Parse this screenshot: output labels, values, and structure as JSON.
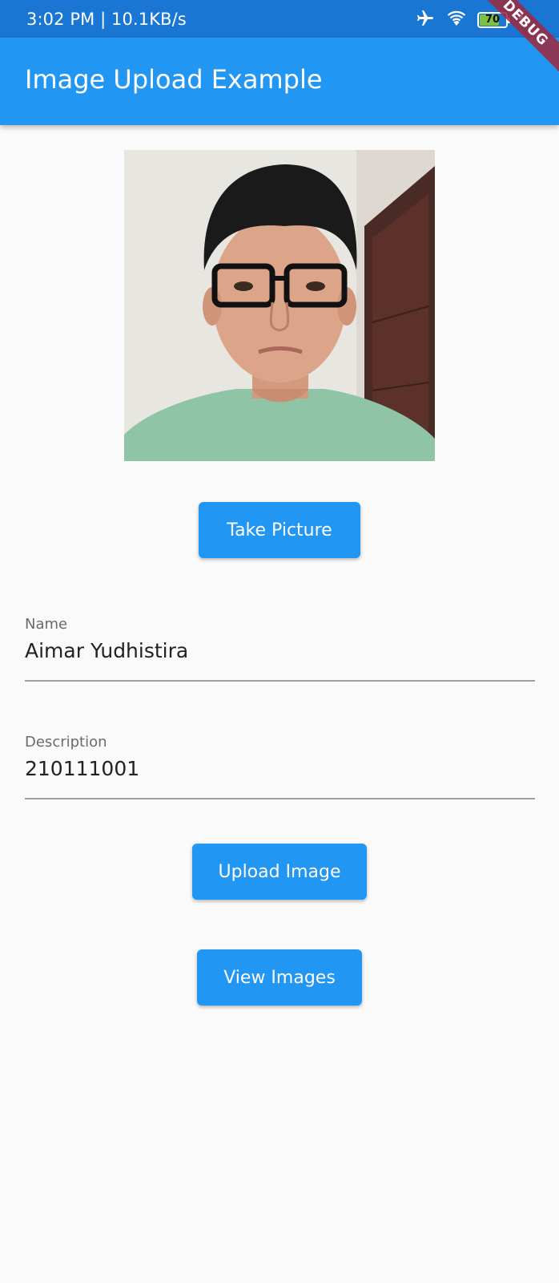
{
  "status_bar": {
    "time_speed": "3:02 PM | 10.1KB/s",
    "battery_level": "70",
    "icons": [
      "airplane-mode-icon",
      "wifi-icon",
      "battery-icon",
      "charging-bolt-icon"
    ]
  },
  "debug_banner": "DEBUG",
  "app_bar": {
    "title": "Image Upload Example",
    "color": "#2196f3"
  },
  "photo": {
    "alt": "Captured selfie photo"
  },
  "buttons": {
    "take_picture": "Take Picture",
    "upload_image": "Upload Image",
    "view_images": "View Images"
  },
  "form": {
    "name": {
      "label": "Name",
      "value": "Aimar Yudhistira"
    },
    "description": {
      "label": "Description",
      "value": "210111001"
    }
  },
  "colors": {
    "primary": "#2196f3",
    "status_bar": "#1976d2",
    "background": "#fafafa"
  }
}
